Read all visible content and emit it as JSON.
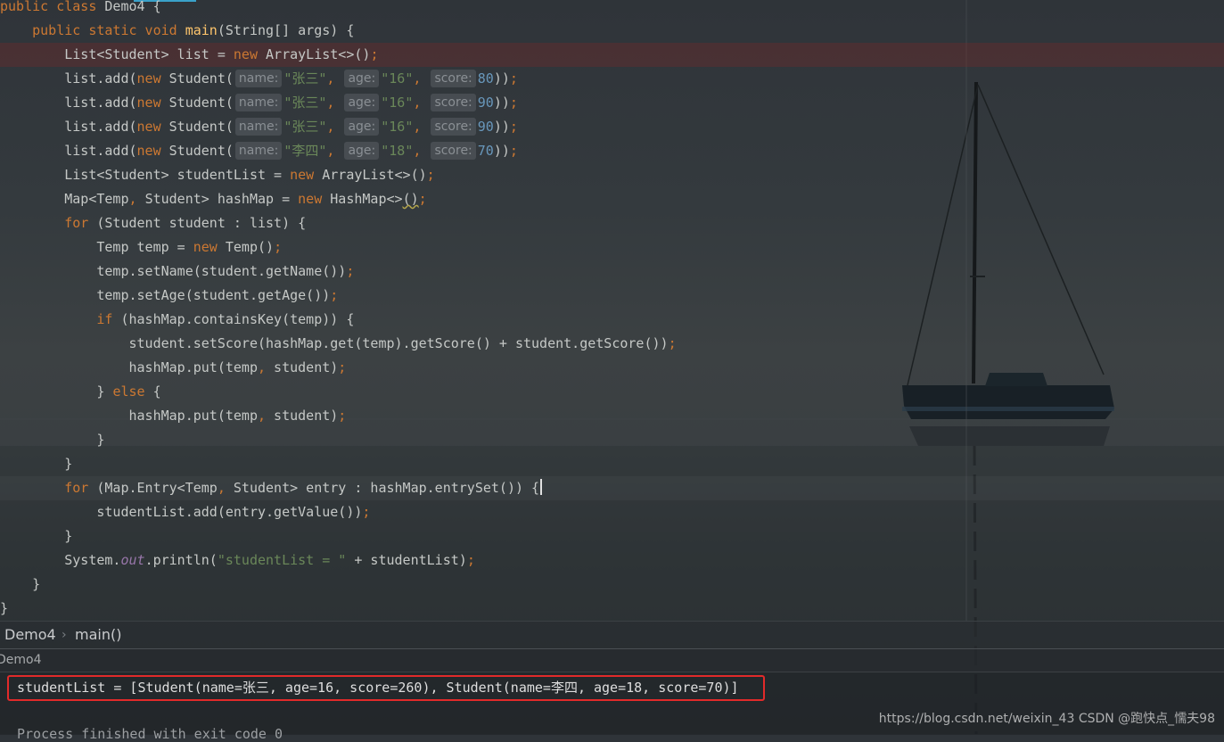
{
  "editor": {
    "lines": [
      [
        {
          "t": "public class ",
          "c": "kw"
        },
        {
          "t": "Demo4 {",
          "c": ""
        }
      ],
      [
        {
          "t": "    ",
          "c": ""
        },
        {
          "t": "public static void ",
          "c": "kw"
        },
        {
          "t": "main",
          "c": "fn"
        },
        {
          "t": "(String[] args) {",
          "c": ""
        }
      ],
      [
        {
          "t": "        List<Student> list = ",
          "c": ""
        },
        {
          "t": "new ",
          "c": "kw"
        },
        {
          "t": "ArrayList<>()",
          "c": ""
        },
        {
          "t": ";",
          "c": "kw"
        }
      ],
      [
        {
          "t": "        list.add(",
          "c": ""
        },
        {
          "t": "new ",
          "c": "kw"
        },
        {
          "t": "Student(",
          "c": ""
        },
        {
          "t": "name:",
          "c": "hint"
        },
        {
          "t": "\"张三\"",
          "c": "str"
        },
        {
          "t": ", ",
          "c": "kw"
        },
        {
          "t": "age:",
          "c": "hint"
        },
        {
          "t": "\"16\"",
          "c": "str"
        },
        {
          "t": ", ",
          "c": "kw"
        },
        {
          "t": "score:",
          "c": "hint"
        },
        {
          "t": "80",
          "c": "num"
        },
        {
          "t": "))",
          "c": ""
        },
        {
          "t": ";",
          "c": "kw"
        }
      ],
      [
        {
          "t": "        list.add(",
          "c": ""
        },
        {
          "t": "new ",
          "c": "kw"
        },
        {
          "t": "Student(",
          "c": ""
        },
        {
          "t": "name:",
          "c": "hint"
        },
        {
          "t": "\"张三\"",
          "c": "str"
        },
        {
          "t": ", ",
          "c": "kw"
        },
        {
          "t": "age:",
          "c": "hint"
        },
        {
          "t": "\"16\"",
          "c": "str"
        },
        {
          "t": ", ",
          "c": "kw"
        },
        {
          "t": "score:",
          "c": "hint"
        },
        {
          "t": "90",
          "c": "num"
        },
        {
          "t": "))",
          "c": ""
        },
        {
          "t": ";",
          "c": "kw"
        }
      ],
      [
        {
          "t": "        list.add(",
          "c": ""
        },
        {
          "t": "new ",
          "c": "kw"
        },
        {
          "t": "Student(",
          "c": ""
        },
        {
          "t": "name:",
          "c": "hint"
        },
        {
          "t": "\"张三\"",
          "c": "str"
        },
        {
          "t": ", ",
          "c": "kw"
        },
        {
          "t": "age:",
          "c": "hint"
        },
        {
          "t": "\"16\"",
          "c": "str"
        },
        {
          "t": ", ",
          "c": "kw"
        },
        {
          "t": "score:",
          "c": "hint"
        },
        {
          "t": "90",
          "c": "num"
        },
        {
          "t": "))",
          "c": ""
        },
        {
          "t": ";",
          "c": "kw"
        }
      ],
      [
        {
          "t": "        list.add(",
          "c": ""
        },
        {
          "t": "new ",
          "c": "kw"
        },
        {
          "t": "Student(",
          "c": ""
        },
        {
          "t": "name:",
          "c": "hint"
        },
        {
          "t": "\"李四\"",
          "c": "str"
        },
        {
          "t": ", ",
          "c": "kw"
        },
        {
          "t": "age:",
          "c": "hint"
        },
        {
          "t": "\"18\"",
          "c": "str"
        },
        {
          "t": ", ",
          "c": "kw"
        },
        {
          "t": "score:",
          "c": "hint"
        },
        {
          "t": "70",
          "c": "num"
        },
        {
          "t": "))",
          "c": ""
        },
        {
          "t": ";",
          "c": "kw"
        }
      ],
      [
        {
          "t": "        List<Student> studentList = ",
          "c": ""
        },
        {
          "t": "new ",
          "c": "kw"
        },
        {
          "t": "ArrayList<>()",
          "c": ""
        },
        {
          "t": ";",
          "c": "kw"
        }
      ],
      [
        {
          "t": "        Map<Temp",
          "c": ""
        },
        {
          "t": ", ",
          "c": "kw"
        },
        {
          "t": "Student> hashMap = ",
          "c": ""
        },
        {
          "t": "new ",
          "c": "kw"
        },
        {
          "t": "HashMap<>",
          "c": ""
        },
        {
          "t": "()",
          "c": "squig"
        },
        {
          "t": ";",
          "c": "kw"
        }
      ],
      [
        {
          "t": "        ",
          "c": ""
        },
        {
          "t": "for ",
          "c": "kw"
        },
        {
          "t": "(Student student : list) {",
          "c": ""
        }
      ],
      [
        {
          "t": "            Temp temp = ",
          "c": ""
        },
        {
          "t": "new ",
          "c": "kw"
        },
        {
          "t": "Temp()",
          "c": ""
        },
        {
          "t": ";",
          "c": "kw"
        }
      ],
      [
        {
          "t": "            temp.setName(student.getName())",
          "c": ""
        },
        {
          "t": ";",
          "c": "kw"
        }
      ],
      [
        {
          "t": "            temp.setAge(student.getAge())",
          "c": ""
        },
        {
          "t": ";",
          "c": "kw"
        }
      ],
      [
        {
          "t": "            ",
          "c": ""
        },
        {
          "t": "if ",
          "c": "kw"
        },
        {
          "t": "(hashMap.containsKey(temp)) {",
          "c": ""
        }
      ],
      [
        {
          "t": "                student.setScore(hashMap.get(temp).getScore() + student.getScore())",
          "c": ""
        },
        {
          "t": ";",
          "c": "kw"
        }
      ],
      [
        {
          "t": "                hashMap.put(temp",
          "c": ""
        },
        {
          "t": ", ",
          "c": "kw"
        },
        {
          "t": "student)",
          "c": ""
        },
        {
          "t": ";",
          "c": "kw"
        }
      ],
      [
        {
          "t": "            } ",
          "c": ""
        },
        {
          "t": "else ",
          "c": "kw"
        },
        {
          "t": "{",
          "c": ""
        }
      ],
      [
        {
          "t": "                hashMap.put(temp",
          "c": ""
        },
        {
          "t": ", ",
          "c": "kw"
        },
        {
          "t": "student)",
          "c": ""
        },
        {
          "t": ";",
          "c": "kw"
        }
      ],
      [
        {
          "t": "            }",
          "c": ""
        }
      ],
      [
        {
          "t": "        }",
          "c": ""
        }
      ],
      [
        {
          "t": "        ",
          "c": ""
        },
        {
          "t": "for ",
          "c": "kw"
        },
        {
          "t": "(Map.Entry<Temp",
          "c": ""
        },
        {
          "t": ", ",
          "c": "kw"
        },
        {
          "t": "Student> entry : hashMap.entrySet()) {",
          "c": ""
        },
        {
          "t": "",
          "c": "caret"
        }
      ],
      [
        {
          "t": "            studentList.add(entry.getValue())",
          "c": ""
        },
        {
          "t": ";",
          "c": "kw"
        }
      ],
      [
        {
          "t": "        }",
          "c": ""
        }
      ],
      [
        {
          "t": "        System.",
          "c": ""
        },
        {
          "t": "out",
          "c": "it"
        },
        {
          "t": ".println(",
          "c": ""
        },
        {
          "t": "\"studentList = \"",
          "c": "str"
        },
        {
          "t": " + studentList)",
          "c": ""
        },
        {
          "t": ";",
          "c": "kw"
        }
      ],
      [
        {
          "t": "    }",
          "c": ""
        }
      ],
      [
        {
          "t": "}",
          "c": ""
        }
      ]
    ]
  },
  "breadcrumb": {
    "class_name": "Demo4",
    "separator": "›",
    "method_name": "main()"
  },
  "run_panel": {
    "tab_label": "Demo4"
  },
  "console": {
    "output_line": "studentList = [Student(name=张三, age=16, score=260), Student(name=李四, age=18, score=70)]",
    "cut_line": "Process finished with exit code 0",
    "highlight_color": "#e22a2a"
  },
  "watermark": {
    "text": "https://blog.csdn.net/weixin_43 CSDN @跑快点_懦夫98"
  },
  "colors": {
    "keyword": "#cc7832",
    "string": "#6a8759",
    "number": "#6897bb",
    "function": "#ffc66d",
    "accent": "#3aa1c9"
  }
}
